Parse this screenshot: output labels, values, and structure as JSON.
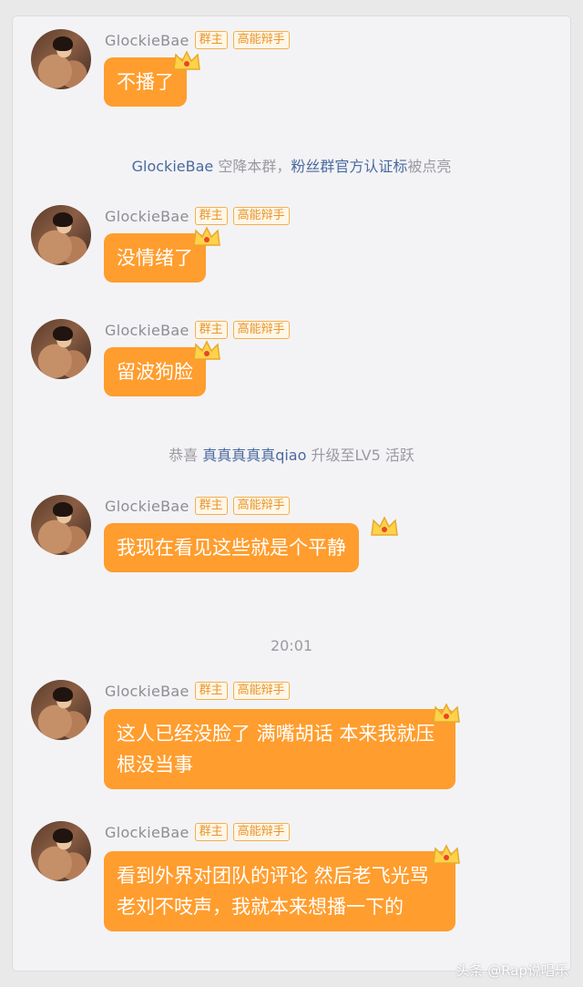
{
  "messages": [
    {
      "name": "GlockieBae",
      "badge_owner": "群主",
      "badge_title": "高能辩手",
      "text": "不播了"
    },
    {
      "name": "GlockieBae",
      "badge_owner": "群主",
      "badge_title": "高能辩手",
      "text": "没情绪了"
    },
    {
      "name": "GlockieBae",
      "badge_owner": "群主",
      "badge_title": "高能辩手",
      "text": "留波狗脸"
    },
    {
      "name": "GlockieBae",
      "badge_owner": "群主",
      "badge_title": "高能辩手",
      "text": "我现在看见这些就是个平静"
    },
    {
      "name": "GlockieBae",
      "badge_owner": "群主",
      "badge_title": "高能辩手",
      "text": "这人已经没脸了 满嘴胡话 本来我就压根没当事"
    },
    {
      "name": "GlockieBae",
      "badge_owner": "群主",
      "badge_title": "高能辩手",
      "text": "看到外界对团队的评论 然后老飞光骂 老刘不吱声，我就本来想播一下的"
    }
  ],
  "system1": {
    "user": "GlockieBae",
    "middle": " 空降本群，",
    "link": "粉丝群官方认证标",
    "end": "被点亮"
  },
  "system2": {
    "prefix": "恭喜 ",
    "user": "真真真真真qiao",
    "end": " 升级至LV5 活跃"
  },
  "timestamp": "20:01",
  "watermark": "头条 @Rap说唱乐",
  "colors": {
    "bubble": "#ff9d2e",
    "link": "#4a6a9e",
    "badge": "#e8952a"
  }
}
